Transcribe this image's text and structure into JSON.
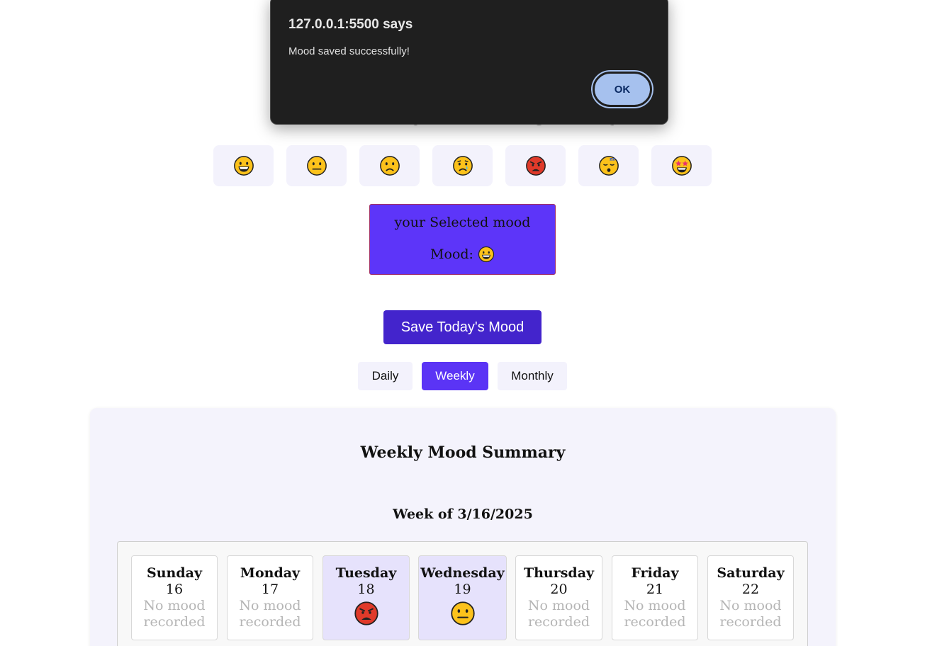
{
  "page": {
    "title": "How are you feeling today?"
  },
  "emojis": [
    {
      "name": "grinning",
      "icon": "grinning-face-icon"
    },
    {
      "name": "neutral",
      "icon": "neutral-face-icon"
    },
    {
      "name": "confused",
      "icon": "slightly-frowning-face-icon"
    },
    {
      "name": "sad",
      "icon": "crying-face-icon"
    },
    {
      "name": "angry",
      "icon": "angry-face-icon"
    },
    {
      "name": "sleepy",
      "icon": "sleeping-face-icon"
    },
    {
      "name": "excited",
      "icon": "star-struck-face-icon"
    }
  ],
  "selected": {
    "title": "your Selected mood",
    "mood_label": "Mood:",
    "mood_icon": "grinning-face-icon"
  },
  "save_button": {
    "label": "Save Today's Mood"
  },
  "tabs": [
    {
      "label": "Daily",
      "active": false
    },
    {
      "label": "Weekly",
      "active": true
    },
    {
      "label": "Monthly",
      "active": false
    }
  ],
  "summary": {
    "title": "Weekly Mood Summary",
    "week_label": "Week of 3/16/2025",
    "days": [
      {
        "name": "Sunday",
        "date": "16",
        "status": "No mood recorded",
        "mood": null
      },
      {
        "name": "Monday",
        "date": "17",
        "status": "No mood recorded",
        "mood": null
      },
      {
        "name": "Tuesday",
        "date": "18",
        "status": "",
        "mood": "angry-face-icon"
      },
      {
        "name": "Wednesday",
        "date": "19",
        "status": "",
        "mood": "neutral-face-icon"
      },
      {
        "name": "Thursday",
        "date": "20",
        "status": "No mood recorded",
        "mood": null
      },
      {
        "name": "Friday",
        "date": "21",
        "status": "No mood recorded",
        "mood": null
      },
      {
        "name": "Saturday",
        "date": "22",
        "status": "No mood recorded",
        "mood": null
      }
    ]
  },
  "alert": {
    "origin": "127.0.0.1:5500 says",
    "message": "Mood saved successfully!",
    "ok_label": "OK"
  },
  "colors": {
    "accent": "#5b34f5",
    "save_button": "#4324cc",
    "selected_box": "#5d35f9",
    "emoji_tile": "#f3f2fc",
    "recorded_day": "#e6e2fc",
    "alert_bg": "#1f1f1f",
    "alert_ok": "#a6c1ee"
  }
}
